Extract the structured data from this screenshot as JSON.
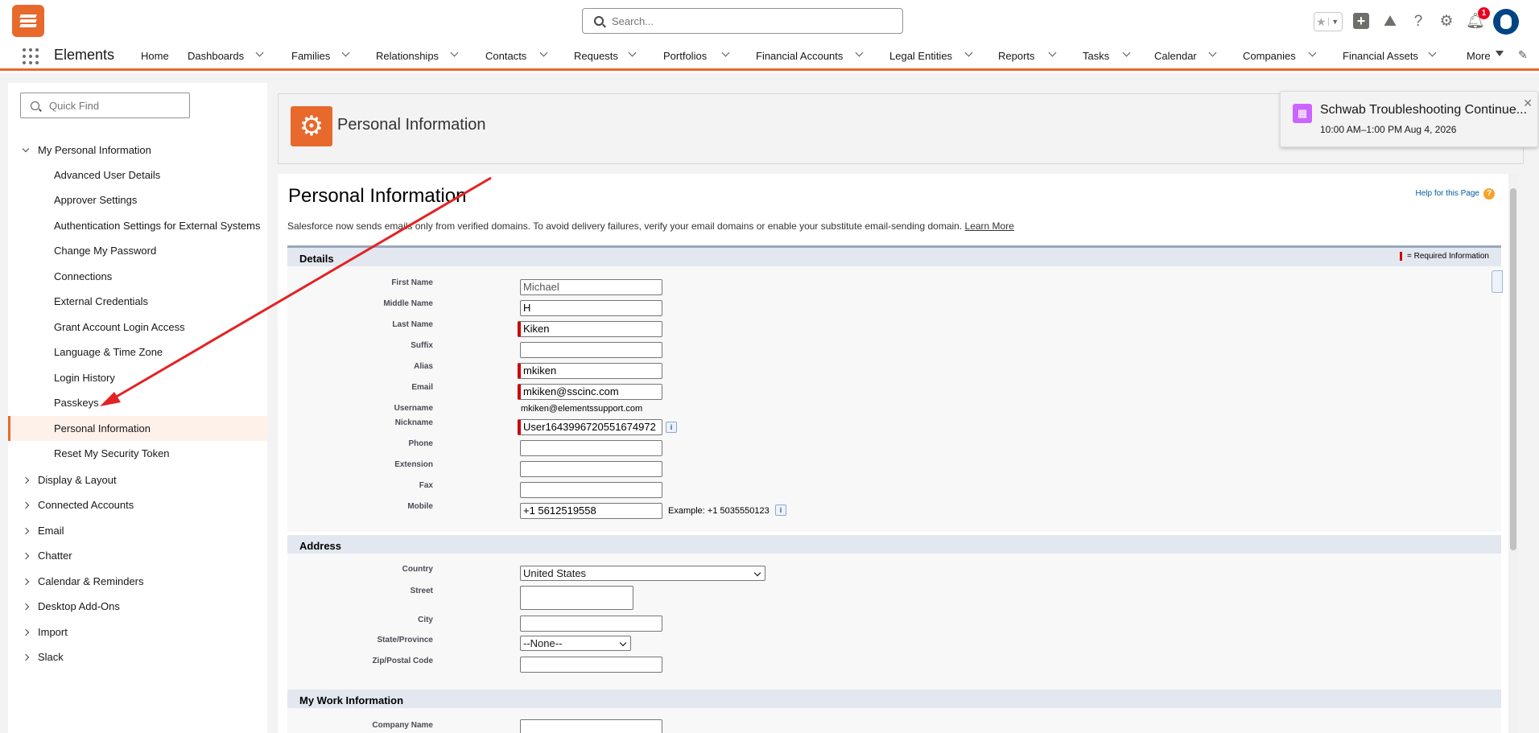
{
  "header": {
    "search_placeholder": "Search...",
    "notifications_count": "1"
  },
  "nav": {
    "app_name": "Elements",
    "items": [
      "Home",
      "Dashboards",
      "Families",
      "Relationships",
      "Contacts",
      "Requests",
      "Portfolios",
      "Financial Accounts",
      "Legal Entities",
      "Reports",
      "Tasks",
      "Calendar",
      "Companies",
      "Financial Assets"
    ],
    "more_label": "More"
  },
  "sidebar": {
    "quick_find_placeholder": "Quick Find",
    "open_group": "My Personal Information",
    "sub_items": [
      "Advanced User Details",
      "Approver Settings",
      "Authentication Settings for External Systems",
      "Change My Password",
      "Connections",
      "External Credentials",
      "Grant Account Login Access",
      "Language & Time Zone",
      "Login History",
      "Passkeys",
      "Personal Information",
      "Reset My Security Token"
    ],
    "active_item": "Personal Information",
    "groups": [
      "Display & Layout",
      "Connected Accounts",
      "Email",
      "Chatter",
      "Calendar & Reminders",
      "Desktop Add-Ons",
      "Import",
      "Slack"
    ]
  },
  "page_header": {
    "title": "Personal Information"
  },
  "toast": {
    "title": "Schwab Troubleshooting Continue...",
    "time": "10:00 AM–1:00 PM Aug 4, 2026"
  },
  "content": {
    "title": "Personal Information",
    "help_link": "Help for this Page",
    "notice": "Salesforce now sends emails only from verified domains. To avoid delivery failures, verify your email domains or enable your substitute email-sending domain.",
    "notice_link": "Learn More",
    "details_section": "Details",
    "required_note": "= Required Information",
    "fields": {
      "first_name": {
        "label": "First Name",
        "value": "Michael"
      },
      "middle_name": {
        "label": "Middle Name",
        "value": "H"
      },
      "last_name": {
        "label": "Last Name",
        "value": "Kiken"
      },
      "suffix": {
        "label": "Suffix",
        "value": ""
      },
      "alias": {
        "label": "Alias",
        "value": "mkiken"
      },
      "email": {
        "label": "Email",
        "value": "mkiken@sscinc.com"
      },
      "username": {
        "label": "Username",
        "value": "mkiken@elementssupport.com"
      },
      "nickname": {
        "label": "Nickname",
        "value": "User1643996720551674972"
      },
      "phone": {
        "label": "Phone",
        "value": ""
      },
      "extension": {
        "label": "Extension",
        "value": ""
      },
      "fax": {
        "label": "Fax",
        "value": ""
      },
      "mobile": {
        "label": "Mobile",
        "value": "+1 5612519558",
        "example": "Example: +1 5035550123"
      }
    },
    "address_section": "Address",
    "address": {
      "country": {
        "label": "Country",
        "value": "United States"
      },
      "street": {
        "label": "Street",
        "value": ""
      },
      "city": {
        "label": "City",
        "value": ""
      },
      "state": {
        "label": "State/Province",
        "value": "--None--"
      },
      "zip": {
        "label": "Zip/Postal Code",
        "value": ""
      }
    },
    "work_section": "My Work Information",
    "work": {
      "company_name": {
        "label": "Company Name",
        "value": ""
      }
    }
  },
  "colors": {
    "brand": "#e8692c",
    "annotation_arrow": "#e32222",
    "required": "#cc0000"
  }
}
